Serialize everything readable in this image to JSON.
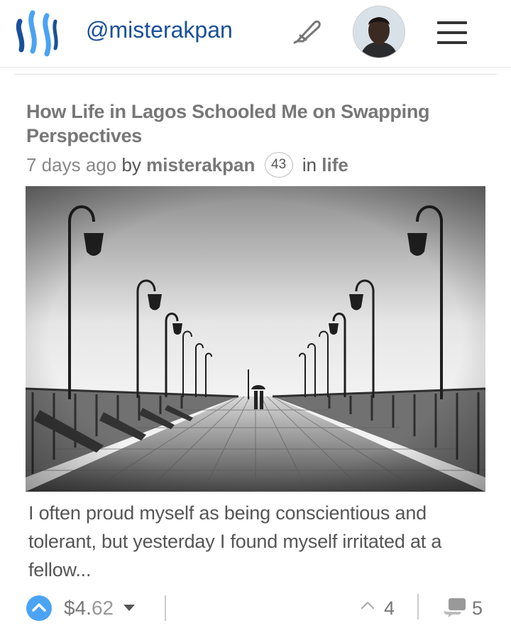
{
  "header": {
    "handle": "@misterakpan",
    "icons": {
      "logo": "steemit-logo",
      "compose": "pen-icon",
      "avatar": "user-avatar",
      "menu": "hamburger-menu-icon"
    }
  },
  "post": {
    "title": "How Life in Lagos Schooled Me on Swapping Perspectives",
    "time": "7 days ago",
    "by": "by",
    "author": "misterakpan",
    "reputation": "43",
    "in": "in",
    "category": "life",
    "excerpt": "I often proud myself as being conscientious and tolerant, but yesterday I found myself irritated at a fellow..."
  },
  "footer": {
    "payout_dollars": "$4.",
    "payout_cents": "62",
    "votes": "4",
    "comments": "5"
  },
  "colors": {
    "brand": "#1a5099",
    "upvote": "#4aa3f3",
    "text": "#777777"
  }
}
